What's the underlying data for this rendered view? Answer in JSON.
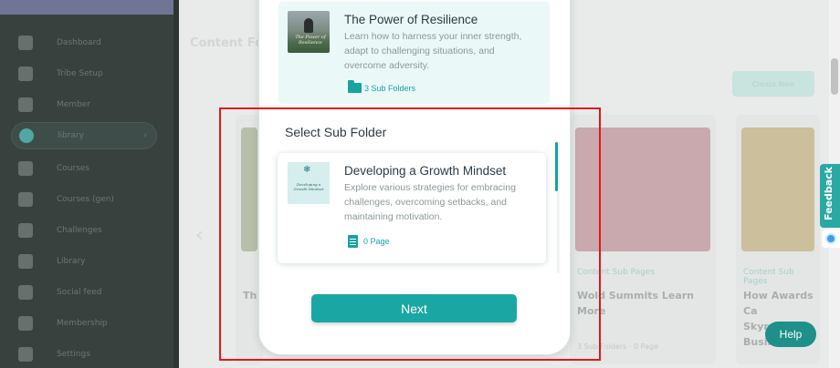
{
  "background": {
    "page_heading": "Content Fo",
    "create_button": "Create New",
    "sidebar": {
      "items": [
        {
          "label": "Dashboard"
        },
        {
          "label": "Tribe Setup"
        },
        {
          "label": "Member"
        },
        {
          "label": "library"
        },
        {
          "label": "Courses"
        },
        {
          "label": "Courses (gen)"
        },
        {
          "label": "Challenges"
        },
        {
          "label": "Library"
        },
        {
          "label": "Social feed"
        },
        {
          "label": "Membership"
        },
        {
          "label": "Settings"
        }
      ]
    },
    "cards": [
      {
        "tag": "",
        "title": "Th",
        "meta": ""
      },
      {
        "tag": "Content Sub Pages",
        "title": "Wold Summits Learn More",
        "meta": "3 Sub Folders · 0 Page"
      },
      {
        "tag": "Content Sub Pages",
        "title": "How Awards Ca Skyrocket Busin Succ",
        "meta": ""
      }
    ]
  },
  "feedback_tab": {
    "label": "Feedback"
  },
  "help_button": {
    "label": "Help"
  },
  "modal": {
    "parent_folder": {
      "title": "The Power of Resilience",
      "description": "Learn how to harness your inner strength, adapt to challenging situations, and overcome adversity.",
      "count": "3 Sub Folders",
      "thumbnail_text": "The Power of Resilience"
    },
    "section_title": "Select Sub Folder",
    "sub_folders": [
      {
        "title": "Developing a Growth Mindset",
        "description": "Explore various strategies for embracing challenges, overcoming setbacks, and maintaining motivation.",
        "count": "0 Page",
        "thumbnail_text": "Developing a Growth Mindset"
      }
    ],
    "next_button": "Next"
  },
  "colors": {
    "accent": "#1aa7a3",
    "annotation": "#e3161b"
  },
  "icons": [
    "folder-icon",
    "page-icon",
    "feedback-icon",
    "chevron-left-icon"
  ]
}
